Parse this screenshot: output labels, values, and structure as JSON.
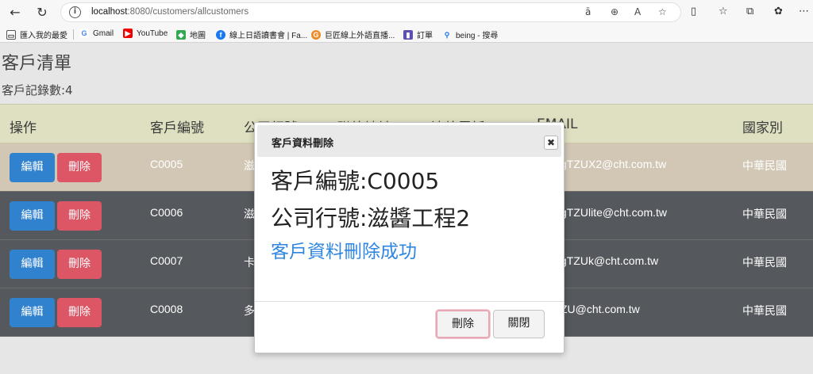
{
  "browser": {
    "url_host": "localhost",
    "url_path": ":8080/customers/allcustomers",
    "bookmarks": [
      {
        "label": "匯入我的最愛",
        "icon": "folder-icon"
      },
      {
        "label": "Gmail",
        "icon": "google-icon"
      },
      {
        "label": "YouTube",
        "icon": "youtube-icon"
      },
      {
        "label": "地圖",
        "icon": "maps-icon"
      },
      {
        "label": "線上日語讀書會 | Fa...",
        "icon": "facebook-icon"
      },
      {
        "label": "巨匠線上外語直播...",
        "icon": "orange-g-icon"
      },
      {
        "label": "訂單",
        "icon": "book-icon"
      },
      {
        "label": "being - 搜尋",
        "icon": "search-icon"
      }
    ]
  },
  "page": {
    "title": "客戶清單",
    "record_count": "客戶記錄數:4"
  },
  "table": {
    "headers": [
      "操作",
      "客戶編號",
      "公司行號",
      "聯絡地址",
      "連絡電話",
      "EMAIL",
      "國家別"
    ],
    "edit_label": "編輯",
    "delete_label": "刪除",
    "rows": [
      {
        "id": "C0005",
        "company": "滋",
        "email": "gTZUX2@cht.com.tw",
        "country": "中華民國"
      },
      {
        "id": "C0006",
        "company": "滋",
        "email": "gTZUlite@cht.com.tw",
        "country": "中華民國"
      },
      {
        "id": "C0007",
        "company": "卡",
        "email": "gTZUk@cht.com.tw",
        "country": "中華民國"
      },
      {
        "id": "C0008",
        "company": "多",
        "email": "ZU@cht.com.tw",
        "country": "中華民國"
      }
    ]
  },
  "modal": {
    "title": "客戶資料刪除",
    "close_symbol": "✖",
    "customer_id_line": "客戶編號:C0005",
    "company_line": "公司行號:滋醬工程2",
    "message": "客戶資料刪除成功",
    "delete_button": "刪除",
    "close_button": "關閉"
  },
  "colors": {
    "edit_button": "#3182ce",
    "delete_button": "#dc5665",
    "success_text": "#2f86e0",
    "header_bg": "#dfdfc1"
  }
}
